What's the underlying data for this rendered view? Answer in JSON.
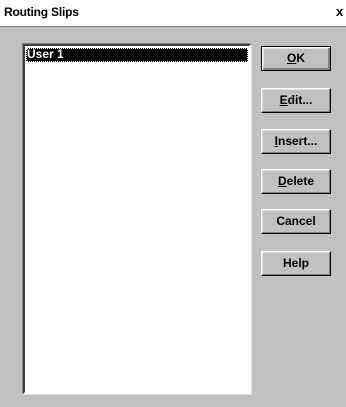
{
  "window": {
    "title": "Routing Slips",
    "close_glyph": "x"
  },
  "list": {
    "items": [
      {
        "label": "User 1",
        "selected": true
      }
    ]
  },
  "buttons": {
    "ok": {
      "accel": "O",
      "rest": "K"
    },
    "edit": {
      "accel": "E",
      "rest": "dit..."
    },
    "insert": {
      "accel": "I",
      "rest": "nsert..."
    },
    "delete": {
      "accel": "D",
      "rest": "elete"
    },
    "cancel": {
      "label": "Cancel"
    },
    "help": {
      "label": "Help"
    }
  }
}
